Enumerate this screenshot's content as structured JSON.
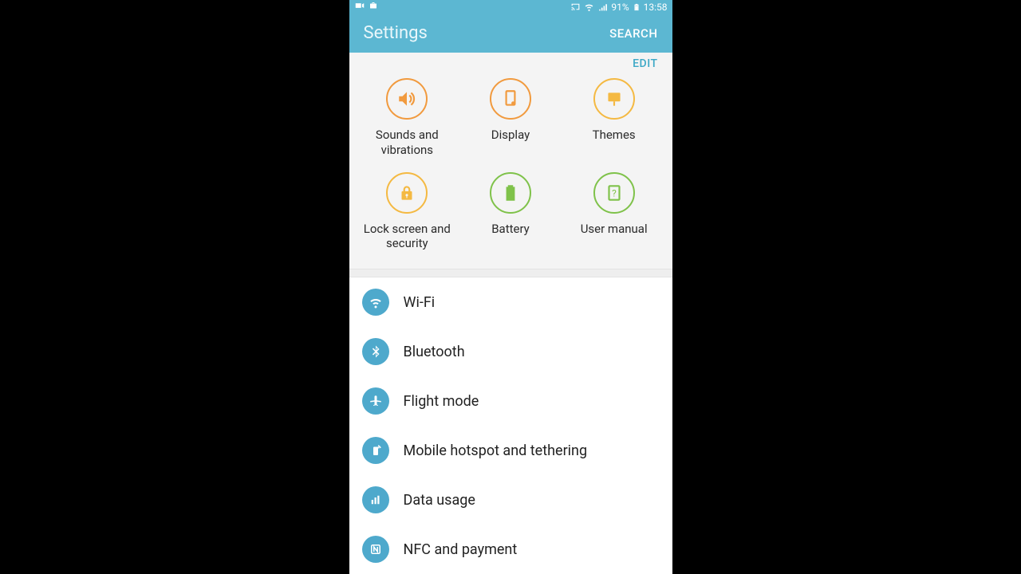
{
  "status": {
    "battery_pct": "91%",
    "time": "13:58"
  },
  "header": {
    "title": "Settings",
    "search_label": "SEARCH"
  },
  "edit": {
    "label": "EDIT"
  },
  "quick": [
    {
      "label": "Sounds and vibrations"
    },
    {
      "label": "Display"
    },
    {
      "label": "Themes"
    },
    {
      "label": "Lock screen and security"
    },
    {
      "label": "Battery"
    },
    {
      "label": "User manual"
    }
  ],
  "list": [
    {
      "label": "Wi-Fi"
    },
    {
      "label": "Bluetooth"
    },
    {
      "label": "Flight mode"
    },
    {
      "label": "Mobile hotspot and tethering"
    },
    {
      "label": "Data usage"
    },
    {
      "label": "NFC and payment"
    }
  ]
}
